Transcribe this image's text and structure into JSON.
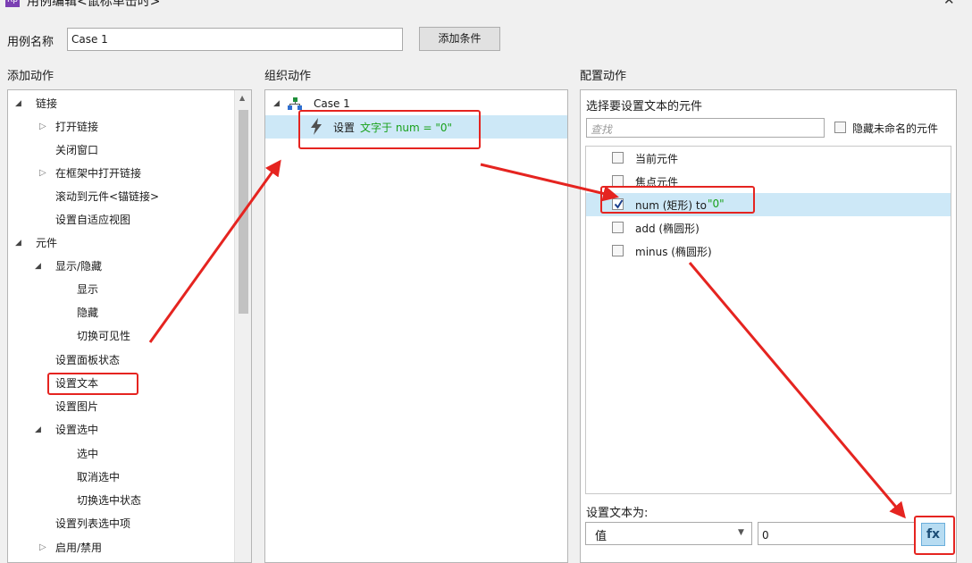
{
  "window": {
    "title": "用例编辑<鼠标单击时>",
    "icon": "Rp"
  },
  "case_name": {
    "label": "用例名称",
    "value": "Case 1",
    "add_condition": "添加条件"
  },
  "add_actions": {
    "title": "添加动作",
    "items": [
      {
        "label": "链接"
      },
      {
        "label": "打开链接"
      },
      {
        "label": "关闭窗口"
      },
      {
        "label": "在框架中打开链接"
      },
      {
        "label": "滚动到元件<锚链接>"
      },
      {
        "label": "设置自适应视图"
      },
      {
        "label": "元件"
      },
      {
        "label": "显示/隐藏"
      },
      {
        "label": "显示"
      },
      {
        "label": "隐藏"
      },
      {
        "label": "切换可见性"
      },
      {
        "label": "设置面板状态"
      },
      {
        "label": "设置文本"
      },
      {
        "label": "设置图片"
      },
      {
        "label": "设置选中"
      },
      {
        "label": "选中"
      },
      {
        "label": "取消选中"
      },
      {
        "label": "切换选中状态"
      },
      {
        "label": "设置列表选中项"
      },
      {
        "label": "启用/禁用"
      }
    ]
  },
  "organize": {
    "title": "组织动作",
    "case_label": "Case 1",
    "action_prefix": "设置",
    "action_detail": "文字于 num = \"0\""
  },
  "configure": {
    "title": "配置动作",
    "subtitle": "选择要设置文本的元件",
    "search_placeholder": "查找",
    "hide_unnamed": "隐藏未命名的元件",
    "widgets": [
      {
        "label": "当前元件",
        "suffix": "",
        "checked": false
      },
      {
        "label": "焦点元件",
        "suffix": "",
        "checked": false
      },
      {
        "label": "num (矩形) to ",
        "suffix": "\"0\"",
        "checked": true
      },
      {
        "label": "add (椭圆形)",
        "suffix": "",
        "checked": false
      },
      {
        "label": "minus (椭圆形)",
        "suffix": "",
        "checked": false
      }
    ],
    "set_text_label": "设置文本为:",
    "type_value": "值",
    "text_value": "0",
    "fx_label": "fx"
  },
  "colors": {
    "accent_red": "#e52420",
    "selection": "#cde8f7",
    "green_text": "#19a11b"
  }
}
